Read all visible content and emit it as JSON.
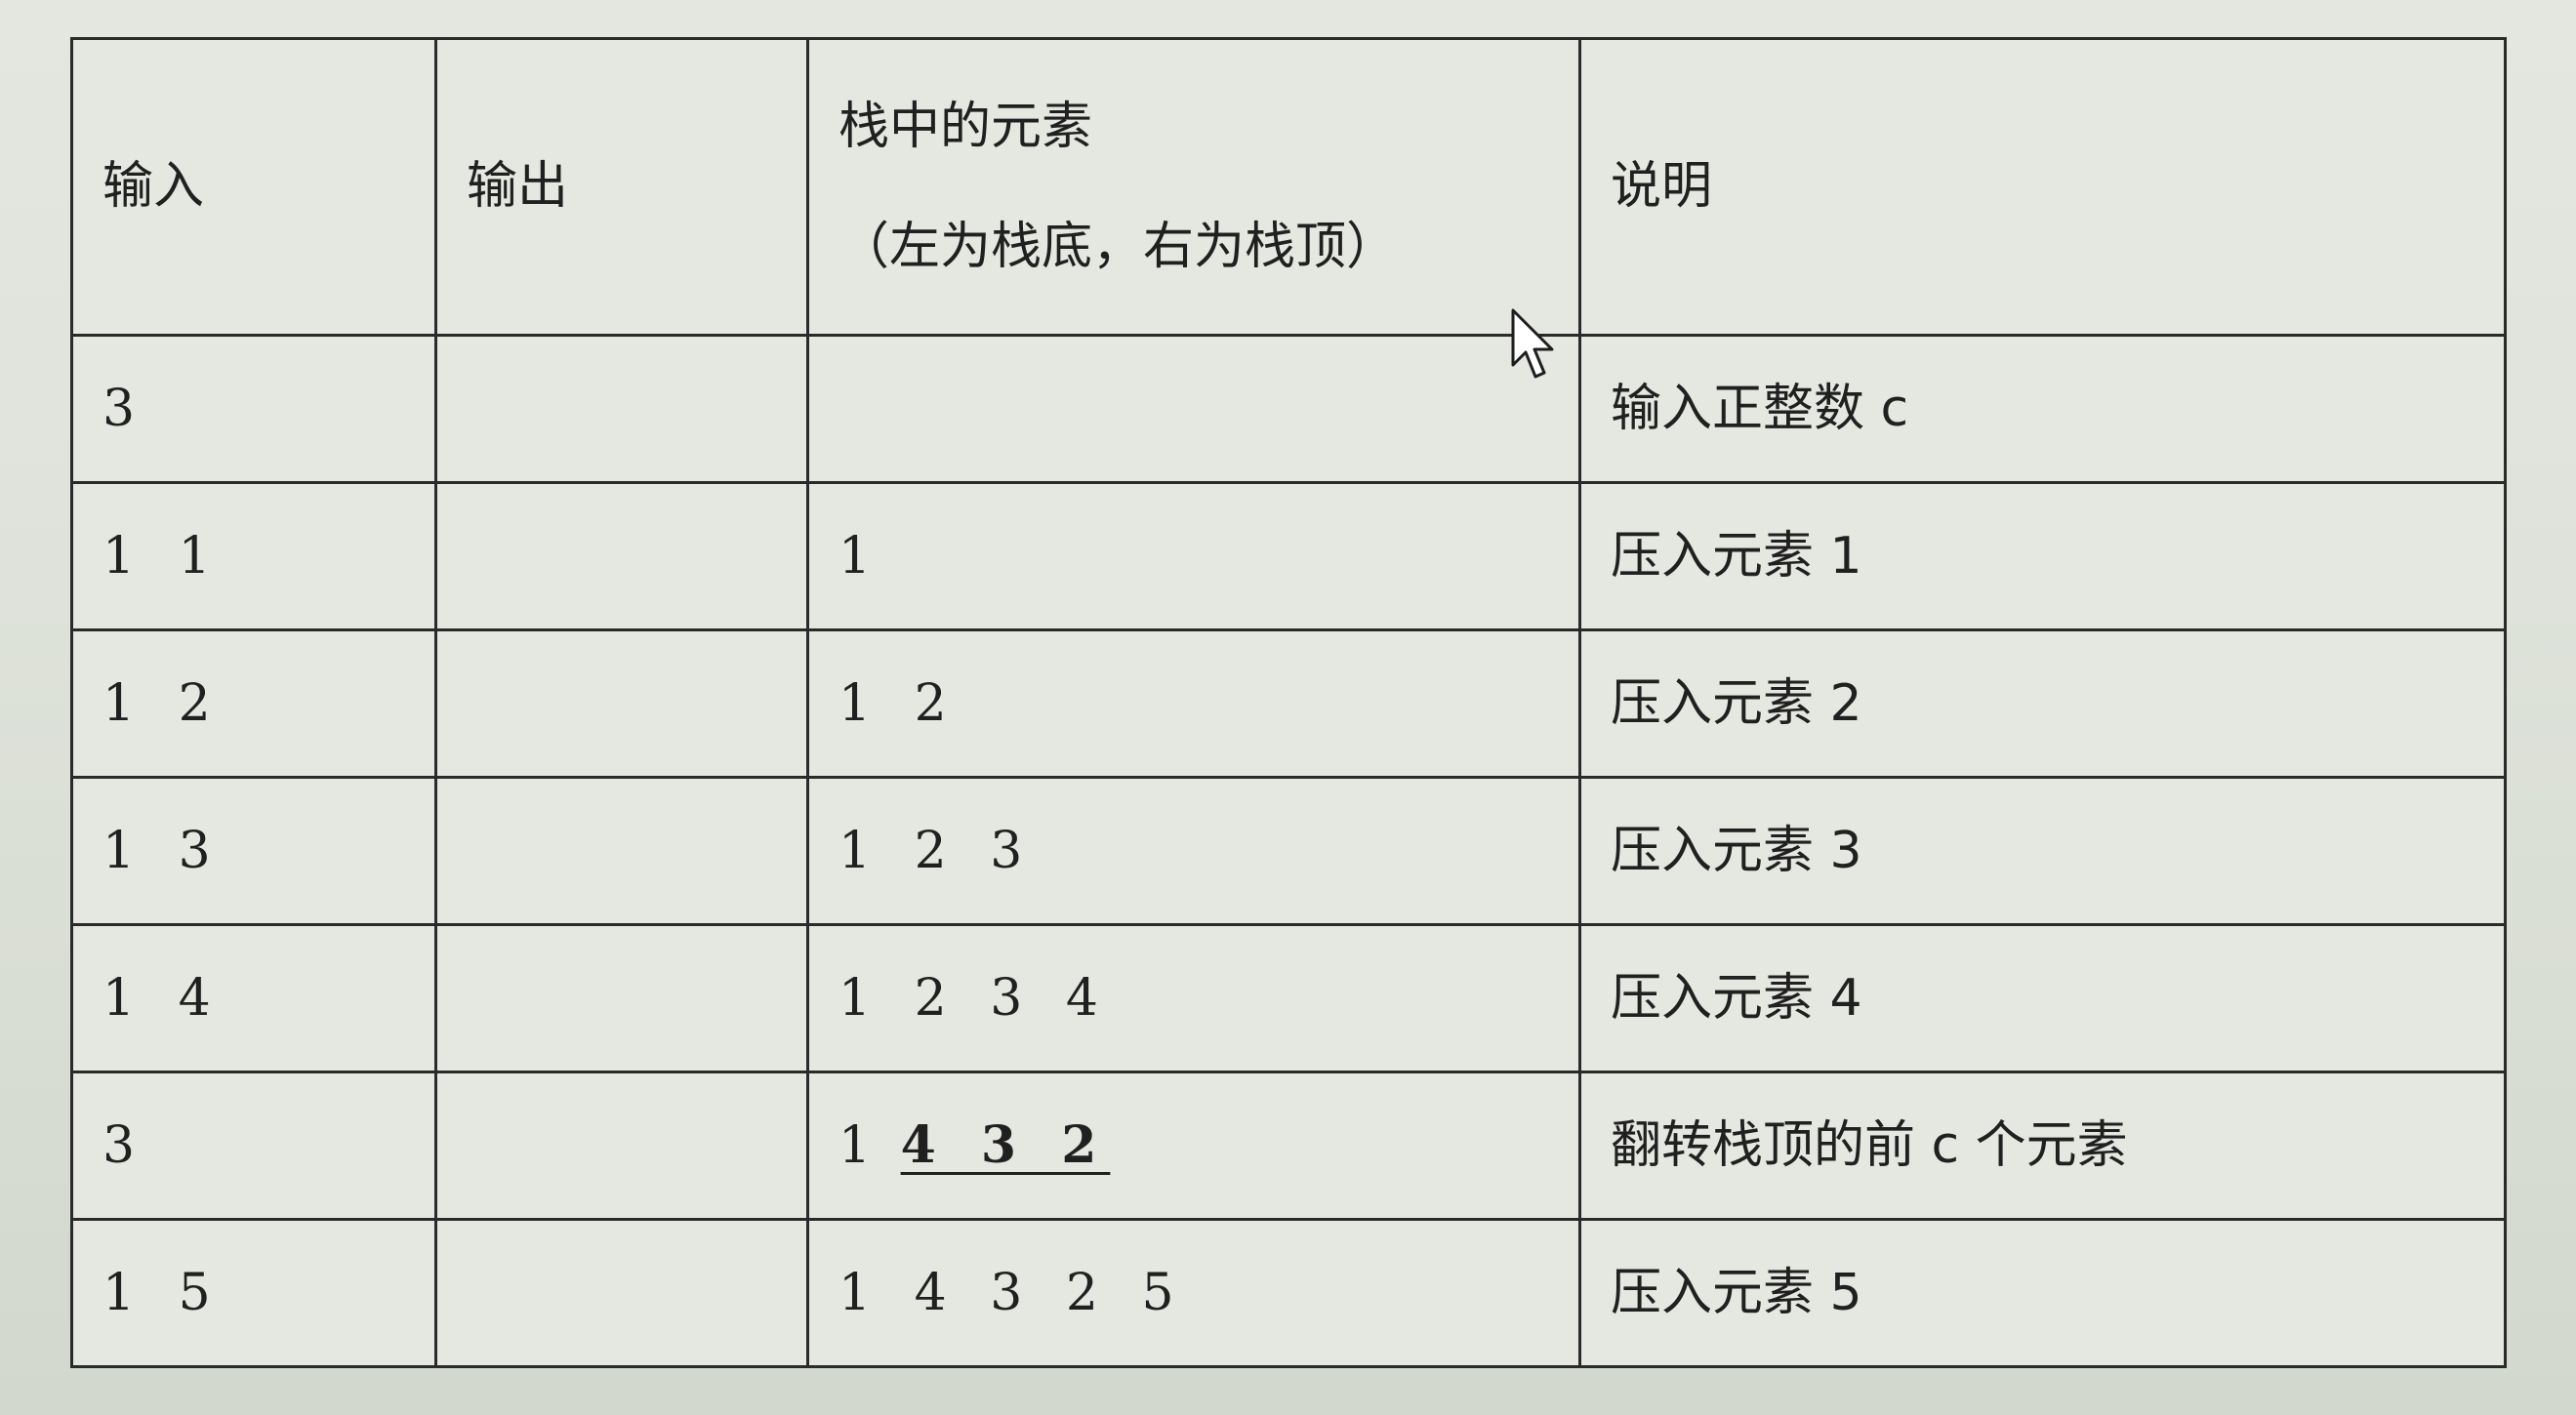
{
  "table": {
    "headers": {
      "input": "输入",
      "output": "输出",
      "stack_title": "栈中的元素",
      "stack_subtitle": "（左为栈底，右为栈顶）",
      "description": "说明"
    },
    "rows": [
      {
        "input": "3",
        "output": "",
        "stack": "",
        "description": "输入正整数 c"
      },
      {
        "input": "1 1",
        "output": "",
        "stack": "1",
        "description": "压入元素 1"
      },
      {
        "input": "1 2",
        "output": "",
        "stack": "1 2",
        "description": "压入元素 2"
      },
      {
        "input": "1 3",
        "output": "",
        "stack": "1 2 3",
        "description": "压入元素 3"
      },
      {
        "input": "1 4",
        "output": "",
        "stack": "1 2 3 4",
        "description": "压入元素 4"
      },
      {
        "input": "3",
        "output": "",
        "stack_prefix": "1",
        "stack_highlight": "4 3 2",
        "description": "翻转栈顶的前 c 个元素"
      },
      {
        "input": "1 5",
        "output": "",
        "stack": "1 4 3 2 5",
        "description": "压入元素 5"
      }
    ]
  },
  "cursor": {
    "icon": "arrow-cursor-icon"
  }
}
